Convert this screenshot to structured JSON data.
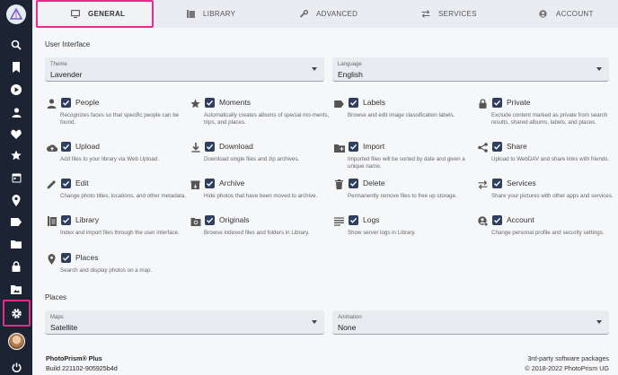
{
  "tabs": [
    {
      "label": "GENERAL",
      "icon": "monitor-icon"
    },
    {
      "label": "LIBRARY",
      "icon": "library-icon"
    },
    {
      "label": "ADVANCED",
      "icon": "wrench-icon"
    },
    {
      "label": "SERVICES",
      "icon": "swap-icon"
    },
    {
      "label": "ACCOUNT",
      "icon": "account-icon"
    }
  ],
  "user_interface": {
    "title": "User Interface",
    "theme": {
      "label": "Theme",
      "value": "Lavender"
    },
    "language": {
      "label": "Language",
      "value": "English"
    }
  },
  "options": [
    {
      "title": "People",
      "icon": "person-icon",
      "checked": true,
      "desc": "Recognizes faces so that specific people can be found."
    },
    {
      "title": "Moments",
      "icon": "star-icon",
      "checked": true,
      "desc": "Automatically creates albums of special mo-ments, trips, and places."
    },
    {
      "title": "Labels",
      "icon": "label-icon",
      "checked": true,
      "desc": "Browse and edit image classification labels."
    },
    {
      "title": "Private",
      "icon": "lock-icon",
      "checked": true,
      "desc": "Exclude content marked as private from search results, shared albums, labels, and places."
    },
    {
      "title": "Upload",
      "icon": "cloud-upload-icon",
      "checked": true,
      "desc": "Add files to your library via Web Upload."
    },
    {
      "title": "Download",
      "icon": "download-icon",
      "checked": true,
      "desc": "Download single files and zip archives."
    },
    {
      "title": "Import",
      "icon": "folder-plus-icon",
      "checked": true,
      "desc": "Imported files will be sorted by date and given a unique name."
    },
    {
      "title": "Share",
      "icon": "share-icon",
      "checked": true,
      "desc": "Upload to WebDAV and share links with friends."
    },
    {
      "title": "Edit",
      "icon": "pencil-icon",
      "checked": true,
      "desc": "Change photo titles, locations, and other metadata."
    },
    {
      "title": "Archive",
      "icon": "archive-icon",
      "checked": true,
      "desc": "Hide photos that have been moved to archive."
    },
    {
      "title": "Delete",
      "icon": "trash-icon",
      "checked": true,
      "desc": "Permanently remove files to free up storage."
    },
    {
      "title": "Services",
      "icon": "swap-icon",
      "checked": true,
      "desc": "Share your pictures with other apps and services."
    },
    {
      "title": "Library",
      "icon": "library-icon",
      "checked": true,
      "desc": "Index and import files through the user interface."
    },
    {
      "title": "Originals",
      "icon": "folder-image-icon",
      "checked": true,
      "desc": "Browse indexed files and folders in Library."
    },
    {
      "title": "Logs",
      "icon": "list-icon",
      "checked": true,
      "desc": "Show server logs in Library."
    },
    {
      "title": "Account",
      "icon": "account-icon",
      "checked": true,
      "desc": "Change personal profile and security settings."
    },
    {
      "title": "Places",
      "icon": "map-pin-icon",
      "checked": true,
      "desc": "Search and display photos on a map."
    }
  ],
  "places": {
    "title": "Places",
    "maps": {
      "label": "Maps",
      "value": "Satellite"
    },
    "animation": {
      "label": "Animation",
      "value": "None"
    }
  },
  "footer": {
    "product": "PhotoPrism® Plus",
    "build": "Build 221102-905925b4d",
    "packages": "3rd-party software packages",
    "copyright": "© 2018-2022 PhotoPrism UG"
  },
  "sidebar_icons": [
    "search-icon",
    "bookmark-icon",
    "play-icon",
    "person-icon",
    "heart-icon",
    "star-icon",
    "calendar-icon",
    "map-pin-icon",
    "label-icon",
    "folder-icon",
    "lock-icon",
    "folder-image-icon",
    "settings-icon",
    "avatar",
    "power-icon"
  ],
  "colors": {
    "accent": "#e62c8c",
    "sidebar": "#1c2434",
    "checkbox": "#2f3f5c"
  }
}
